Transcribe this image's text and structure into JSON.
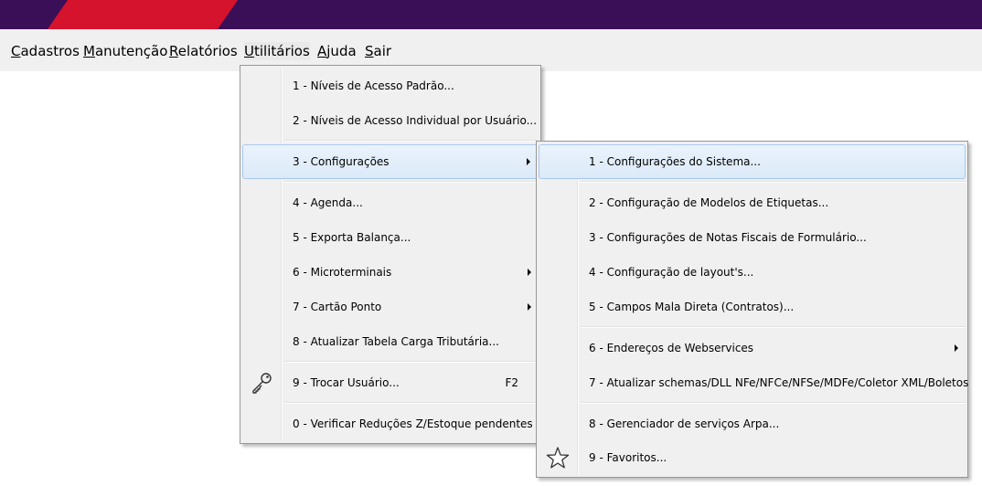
{
  "menubar": {
    "items": [
      {
        "accel": "C",
        "rest": "adastros"
      },
      {
        "accel": "M",
        "rest": "anutenção"
      },
      {
        "accel": "R",
        "rest": "elatórios"
      },
      {
        "accel": "U",
        "rest": "tilitários"
      },
      {
        "accel": "A",
        "rest": "juda"
      },
      {
        "accel": "S",
        "rest": "air"
      }
    ]
  },
  "utilitarios_menu": {
    "items": [
      {
        "label": "1 - Níveis de Acesso Padrão..."
      },
      {
        "label": "2 - Níveis de Acesso Individual por Usuário..."
      },
      {
        "label": "3 - Configurações"
      },
      {
        "label": "4 - Agenda..."
      },
      {
        "label": "5 - Exporta Balança..."
      },
      {
        "label": "6 - Microterminais"
      },
      {
        "label": "7 - Cartão Ponto"
      },
      {
        "label": "8 - Atualizar Tabela Carga Tributária..."
      },
      {
        "label": "9 - Trocar Usuário...",
        "shortcut": "F2",
        "icon": "key-icon"
      },
      {
        "label": "0 - Verificar Reduções Z/Estoque pendentes"
      }
    ]
  },
  "configuracoes_submenu": {
    "items": [
      {
        "label": "1 - Configurações do Sistema..."
      },
      {
        "label": "2 - Configuração de Modelos de Etiquetas..."
      },
      {
        "label": "3 - Configurações de Notas Fiscais de Formulário..."
      },
      {
        "label": "4 - Configuração de layout's..."
      },
      {
        "label": "5 - Campos Mala Direta (Contratos)..."
      },
      {
        "label": "6 - Endereços de Webservices"
      },
      {
        "label": "7 - Atualizar schemas/DLL NFe/NFCe/NFSe/MDFe/Coletor XML/Boletos"
      },
      {
        "label": "8 - Gerenciador de serviços Arpa..."
      },
      {
        "label": "9 - Favoritos...",
        "icon": "star-icon"
      }
    ]
  },
  "colors": {
    "topbar": "#3b0f57",
    "stripe": "#d6132c",
    "menu_bg": "#f0f0f0",
    "highlight_border": "#a8c8ee"
  }
}
